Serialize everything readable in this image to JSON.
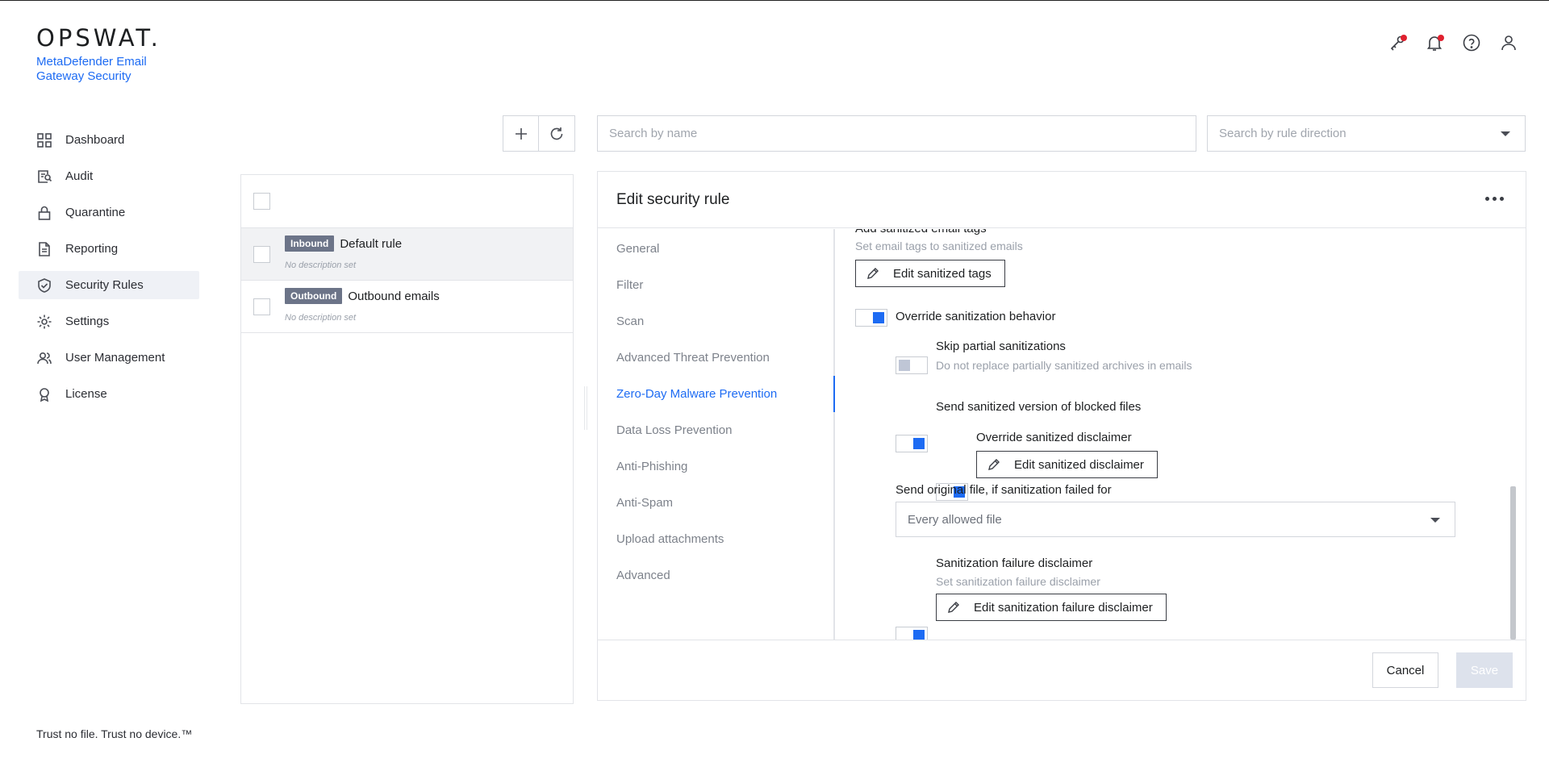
{
  "brand": {
    "logo": "OPSWAT.",
    "product": "MetaDefender Email Gateway Security",
    "tagline": "Trust no file. Trust no device.™"
  },
  "nav": {
    "items": [
      {
        "label": "Dashboard",
        "icon": "dashboard-icon"
      },
      {
        "label": "Audit",
        "icon": "audit-icon"
      },
      {
        "label": "Quarantine",
        "icon": "lock-icon"
      },
      {
        "label": "Reporting",
        "icon": "document-icon"
      },
      {
        "label": "Security Rules",
        "icon": "shield-check-icon"
      },
      {
        "label": "Settings",
        "icon": "gear-icon"
      },
      {
        "label": "User Management",
        "icon": "users-icon"
      },
      {
        "label": "License",
        "icon": "award-icon"
      }
    ],
    "active": "Security Rules"
  },
  "header": {
    "icons": [
      "key-icon",
      "bell-icon",
      "help-icon",
      "user-icon"
    ]
  },
  "search": {
    "name_placeholder": "Search by name",
    "direction_placeholder": "Search by rule direction"
  },
  "rules": [
    {
      "badge": "Inbound",
      "name": "Default rule",
      "desc": "No description set"
    },
    {
      "badge": "Outbound",
      "name": "Outbound emails",
      "desc": "No description set"
    }
  ],
  "editor": {
    "title": "Edit security rule",
    "tabs": [
      "General",
      "Filter",
      "Scan",
      "Advanced Threat Prevention",
      "Zero-Day Malware Prevention",
      "Data Loss Prevention",
      "Anti-Phishing",
      "Anti-Spam",
      "Upload attachments",
      "Advanced"
    ],
    "active_tab": "Zero-Day Malware Prevention",
    "content": {
      "tags_title": "Add sanitized email tags",
      "tags_sub": "Set email tags to sanitized emails",
      "tags_button": "Edit sanitized tags",
      "override_behavior": "Override sanitization behavior",
      "skip_partial": "Skip partial sanitizations",
      "skip_partial_sub": "Do not replace partially sanitized archives in emails",
      "send_sanitized": "Send sanitized version of blocked files",
      "override_disclaimer": "Override sanitized disclaimer",
      "disclaimer_button": "Edit sanitized disclaimer",
      "send_original_label": "Send original file, if sanitization failed for",
      "send_original_value": "Every allowed file",
      "failure_disclaimer": "Sanitization failure disclaimer",
      "failure_disclaimer_sub": "Set sanitization failure disclaimer",
      "failure_button": "Edit sanitization failure disclaimer"
    },
    "cancel": "Cancel",
    "save": "Save"
  },
  "colors": {
    "accent": "#1d6bf3",
    "badge": "#6c7488",
    "alert_dot": "#e0202e"
  }
}
